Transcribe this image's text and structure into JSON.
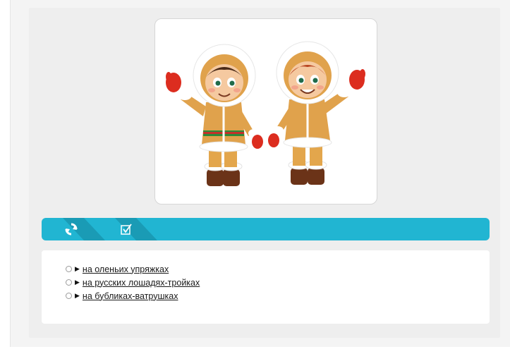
{
  "toolbar": {
    "accent_color": "#21b5d2",
    "buttons": [
      {
        "name": "refresh",
        "icon": "refresh-icon"
      },
      {
        "name": "check",
        "icon": "checkbox-check-icon"
      }
    ]
  },
  "illustration": {
    "subject": "two cartoon children in fur winter parkas waving"
  },
  "answers": {
    "options": [
      {
        "label": "на оленьих упряжках"
      },
      {
        "label": "на русских лошадях-тройках"
      },
      {
        "label": "на бубликах-ватрушках"
      }
    ]
  }
}
